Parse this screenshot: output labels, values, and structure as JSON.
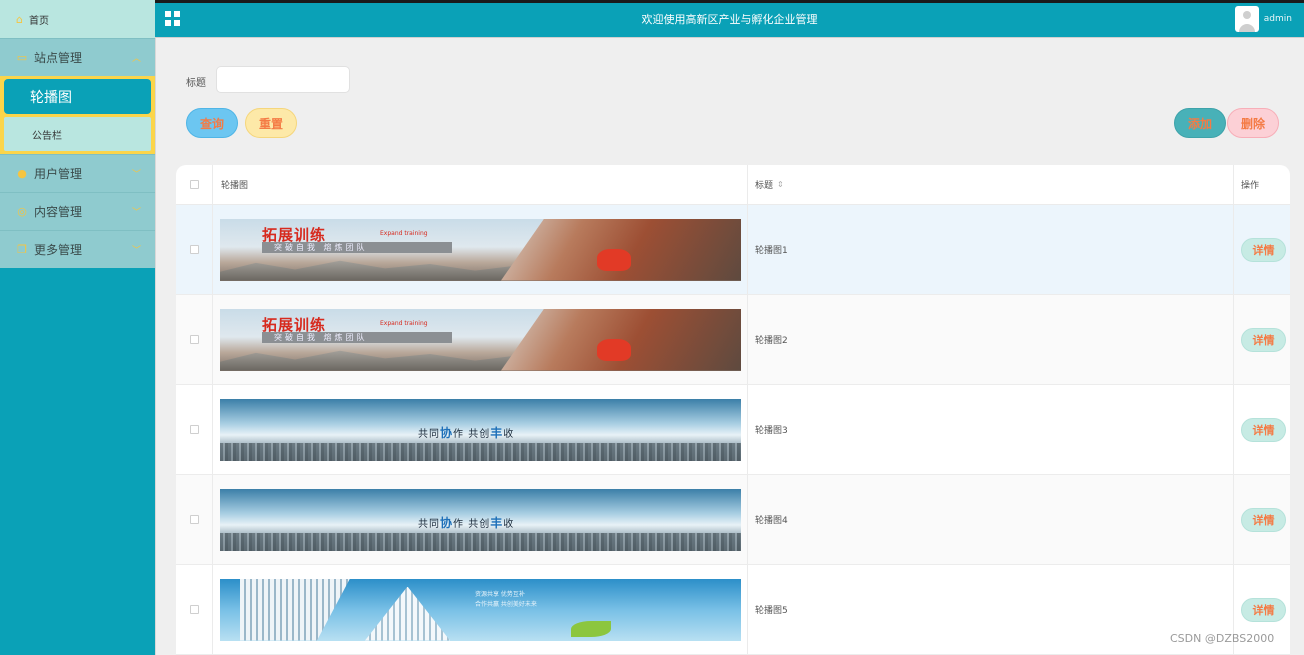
{
  "header": {
    "title": "欢迎使用高新区产业与孵化企业管理",
    "username": "admin"
  },
  "sidebar": {
    "home": "首页",
    "groups": [
      {
        "label": "站点管理",
        "icon": "monitor-icon"
      },
      {
        "label": "用户管理",
        "icon": "user-icon"
      },
      {
        "label": "内容管理",
        "icon": "content-icon"
      },
      {
        "label": "更多管理",
        "icon": "copy-icon"
      }
    ],
    "submenu": {
      "active": "轮播图",
      "other": "公告栏"
    }
  },
  "search": {
    "label": "标题",
    "value": "",
    "placeholder": ""
  },
  "buttons": {
    "query": "查询",
    "reset": "重置",
    "add": "添加",
    "delete": "删除",
    "detail": "详情"
  },
  "table": {
    "columns": {
      "image": "轮播图",
      "title": "标题",
      "actions": "操作"
    },
    "rows": [
      {
        "title": "轮播图1",
        "banner": {
          "main": "拓展训练",
          "sub_en": "Expand training",
          "slogan": "突破自我 熔炼团队"
        }
      },
      {
        "title": "轮播图2",
        "banner": {
          "main": "拓展训练",
          "sub_en": "Expand training",
          "slogan": "突破自我 熔炼团队"
        }
      },
      {
        "title": "轮播图3",
        "banner": {
          "a": "共同",
          "b": "协",
          "c": "作  共创",
          "d": "丰",
          "e": "收"
        }
      },
      {
        "title": "轮播图4",
        "banner": {
          "a": "共同",
          "b": "协",
          "c": "作  共创",
          "d": "丰",
          "e": "收"
        }
      },
      {
        "title": "轮播图5",
        "banner": {
          "line1": "资源共享 优势互补",
          "line2": "合作共赢 共创美好未来"
        }
      }
    ]
  },
  "watermark": "CSDN @DZBS2000",
  "colors": {
    "primary": "#0aa1b7",
    "accent_text": "#f47b45",
    "highlight": "#fbd54a"
  }
}
